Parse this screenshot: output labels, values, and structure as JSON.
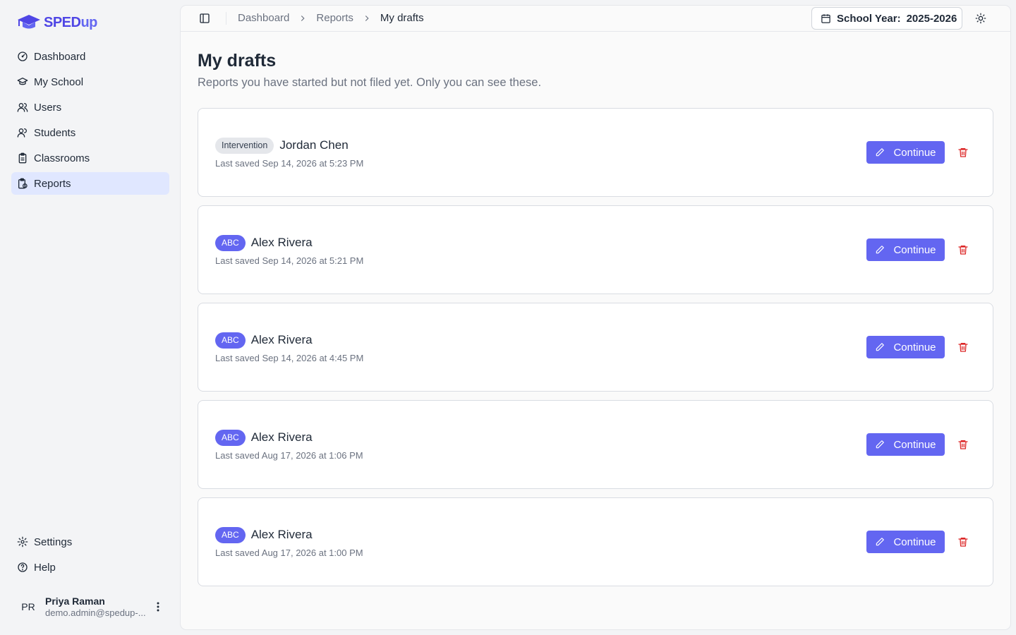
{
  "brand": {
    "part1": "SPED",
    "part2": "up"
  },
  "sidebar": {
    "items": [
      {
        "label": "Dashboard",
        "icon": "dashboard-icon"
      },
      {
        "label": "My School",
        "icon": "graduation-cap-icon"
      },
      {
        "label": "Users",
        "icon": "users-icon"
      },
      {
        "label": "Students",
        "icon": "students-icon"
      },
      {
        "label": "Classrooms",
        "icon": "clipboard-icon"
      },
      {
        "label": "Reports",
        "icon": "report-icon",
        "active": true
      }
    ],
    "bottom": [
      {
        "label": "Settings",
        "icon": "gear-icon"
      },
      {
        "label": "Help",
        "icon": "help-icon"
      }
    ],
    "user": {
      "initials": "PR",
      "name": "Priya Raman",
      "email": "demo.admin@spedup-..."
    }
  },
  "topbar": {
    "breadcrumbs": [
      "Dashboard",
      "Reports",
      "My drafts"
    ],
    "school_year_label": "School Year:",
    "school_year_value": "2025-2026"
  },
  "page": {
    "title": "My drafts",
    "subtitle": "Reports you have started but not filed yet. Only you can see these."
  },
  "drafts": [
    {
      "badge": "Intervention",
      "badge_style": "gray",
      "name": "Jordan Chen",
      "saved": "Last saved Sep 14, 2026 at 5:23 PM",
      "action": "Continue"
    },
    {
      "badge": "ABC",
      "badge_style": "purple",
      "name": "Alex Rivera",
      "saved": "Last saved Sep 14, 2026 at 5:21 PM",
      "action": "Continue"
    },
    {
      "badge": "ABC",
      "badge_style": "purple",
      "name": "Alex Rivera",
      "saved": "Last saved Sep 14, 2026 at 4:45 PM",
      "action": "Continue"
    },
    {
      "badge": "ABC",
      "badge_style": "purple",
      "name": "Alex Rivera",
      "saved": "Last saved Aug 17, 2026 at 1:06 PM",
      "action": "Continue"
    },
    {
      "badge": "ABC",
      "badge_style": "purple",
      "name": "Alex Rivera",
      "saved": "Last saved Aug 17, 2026 at 1:00 PM",
      "action": "Continue"
    }
  ],
  "colors": {
    "accent": "#6366f1",
    "active_nav": "#e0e7ff",
    "danger": "#dc2626"
  }
}
